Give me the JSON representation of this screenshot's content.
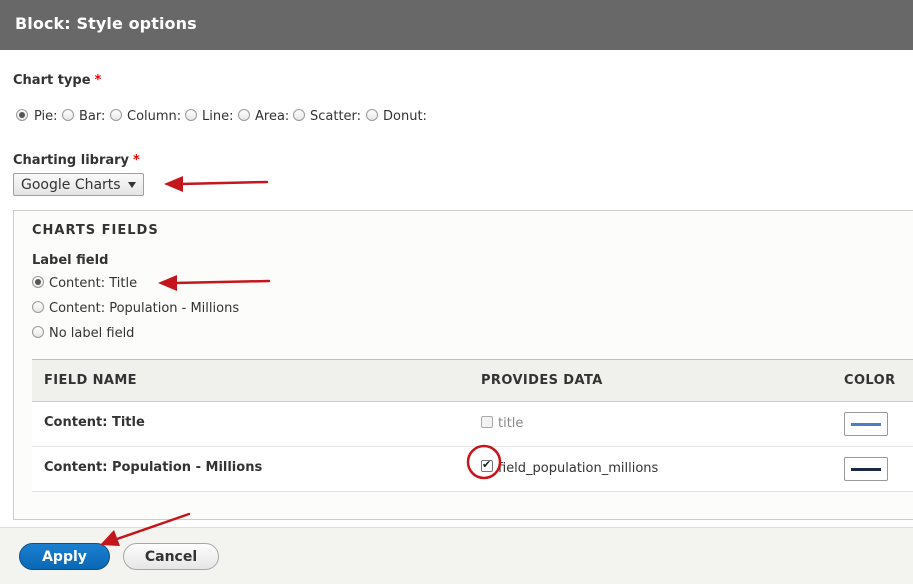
{
  "dialog": {
    "title": "Block: Style options"
  },
  "chart_type": {
    "label": "Chart type",
    "required_mark": "*",
    "options": [
      {
        "label": "Pie:",
        "selected": true
      },
      {
        "label": "Bar:",
        "selected": false
      },
      {
        "label": "Column:",
        "selected": false
      },
      {
        "label": "Line:",
        "selected": false
      },
      {
        "label": "Area:",
        "selected": false
      },
      {
        "label": "Scatter:",
        "selected": false
      },
      {
        "label": "Donut:",
        "selected": false
      }
    ]
  },
  "charting_library": {
    "label": "Charting library",
    "required_mark": "*",
    "selected": "Google Charts"
  },
  "charts_fields": {
    "legend": "CHARTS FIELDS",
    "label_field": {
      "label": "Label field",
      "options": [
        {
          "label": "Content: Title",
          "selected": true
        },
        {
          "label": "Content: Population - Millions",
          "selected": false
        },
        {
          "label": "No label field",
          "selected": false
        }
      ]
    },
    "table": {
      "headers": [
        "FIELD NAME",
        "PROVIDES DATA",
        "COLOR"
      ],
      "rows": [
        {
          "field_name": "Content: Title",
          "data_label": "title",
          "provides_data": false,
          "color": "#4a7ec8"
        },
        {
          "field_name": "Content: Population - Millions",
          "data_label": "field_population_millions",
          "provides_data": true,
          "color": "#1a2a44"
        }
      ]
    }
  },
  "buttons": {
    "apply": "Apply",
    "cancel": "Cancel"
  },
  "annotation_color": "#c4161c"
}
